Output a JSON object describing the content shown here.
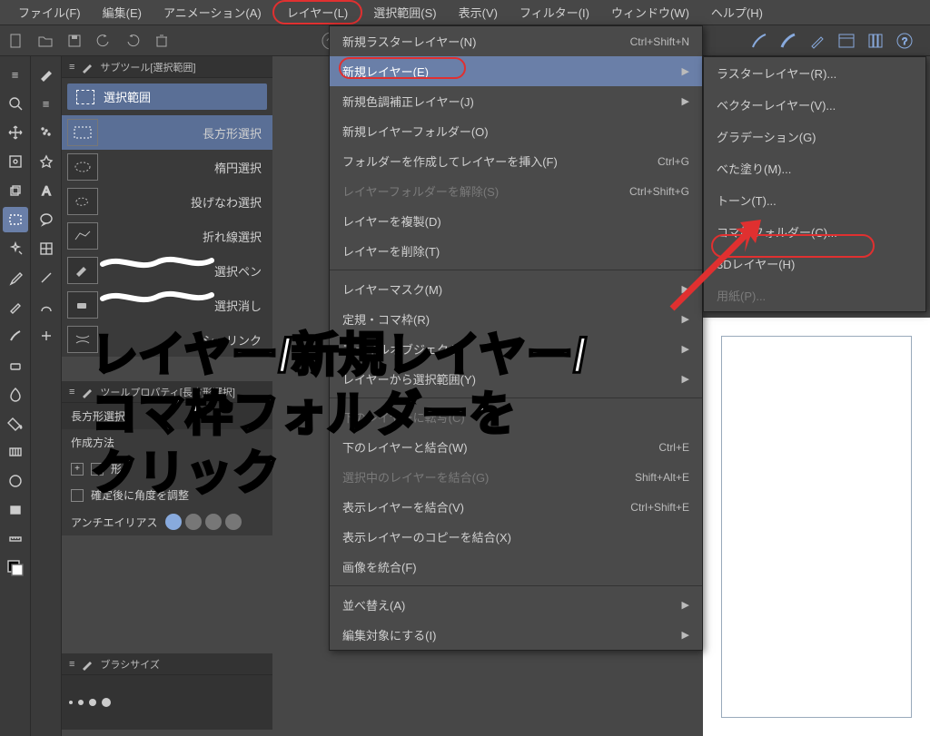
{
  "menubar": {
    "file": "ファイル(F)",
    "edit": "編集(E)",
    "animation": "アニメーション(A)",
    "layer": "レイヤー(L)",
    "selection": "選択範囲(S)",
    "view": "表示(V)",
    "filter": "フィルター(I)",
    "window": "ウィンドウ(W)",
    "help": "ヘルプ(H)"
  },
  "subtool": {
    "title": "サブツール[選択範囲]",
    "tab_label": "選択範囲",
    "items": [
      {
        "lbl": "長方形選択"
      },
      {
        "lbl": "楕円選択"
      },
      {
        "lbl": "投げなわ選択"
      },
      {
        "lbl": "折れ線選択"
      },
      {
        "lbl": "選択ペン"
      },
      {
        "lbl": "選択消し"
      },
      {
        "lbl": "シュリンク"
      }
    ]
  },
  "toolprop": {
    "title": "ツールプロパティ[長方形選択]",
    "header_label": "長方形選択",
    "create_method": "作成方法",
    "shape_label": "形",
    "confirm_angle": "確定後に角度を調整",
    "antialias": "アンチエイリアス"
  },
  "brushsize": {
    "title": "ブラシサイズ"
  },
  "layer_menu": {
    "items": [
      {
        "lbl": "新規ラスターレイヤー(N)",
        "sc": "Ctrl+Shift+N"
      },
      {
        "lbl": "新規レイヤー(E)",
        "arrow": true,
        "highlighted": true
      },
      {
        "lbl": "新規色調補正レイヤー(J)",
        "arrow": true
      },
      {
        "lbl": "新規レイヤーフォルダー(O)"
      },
      {
        "lbl": "フォルダーを作成してレイヤーを挿入(F)",
        "sc": "Ctrl+G"
      },
      {
        "lbl": "レイヤーフォルダーを解除(S)",
        "sc": "Ctrl+Shift+G",
        "disabled": true
      },
      {
        "lbl": "レイヤーを複製(D)"
      },
      {
        "lbl": "レイヤーを削除(T)"
      },
      {
        "divider": true
      },
      {
        "lbl": "レイヤーマスク(M)",
        "arrow": true
      },
      {
        "lbl": "定規・コマ枠(R)",
        "arrow": true
      },
      {
        "lbl": "ファイルオブジェクト",
        "arrow": true
      },
      {
        "lbl": "レイヤーから選択範囲(Y)",
        "arrow": true
      },
      {
        "divider": true
      },
      {
        "lbl": "下のレイヤーに転写(C)",
        "disabled": true
      },
      {
        "lbl": "下のレイヤーと結合(W)",
        "sc": "Ctrl+E"
      },
      {
        "lbl": "選択中のレイヤーを結合(G)",
        "sc": "Shift+Alt+E",
        "disabled": true
      },
      {
        "lbl": "表示レイヤーを結合(V)",
        "sc": "Ctrl+Shift+E"
      },
      {
        "lbl": "表示レイヤーのコピーを結合(X)"
      },
      {
        "lbl": "画像を統合(F)"
      },
      {
        "divider": true
      },
      {
        "lbl": "並べ替え(A)",
        "arrow": true
      },
      {
        "lbl": "編集対象にする(I)",
        "arrow": true
      }
    ]
  },
  "submenu": {
    "items": [
      {
        "lbl": "ラスターレイヤー(R)..."
      },
      {
        "lbl": "ベクターレイヤー(V)..."
      },
      {
        "lbl": "グラデーション(G)"
      },
      {
        "lbl": "べた塗り(M)..."
      },
      {
        "lbl": "トーン(T)..."
      },
      {
        "lbl": "コマ枠フォルダー(C)..."
      },
      {
        "lbl": "3Dレイヤー(H)"
      },
      {
        "lbl": "用紙(P)...",
        "disabled": true
      }
    ]
  },
  "annotation": {
    "line1": "レイヤー/新規レイヤー/",
    "line2": "コマ枠フォルダーを",
    "line3": "クリック"
  }
}
